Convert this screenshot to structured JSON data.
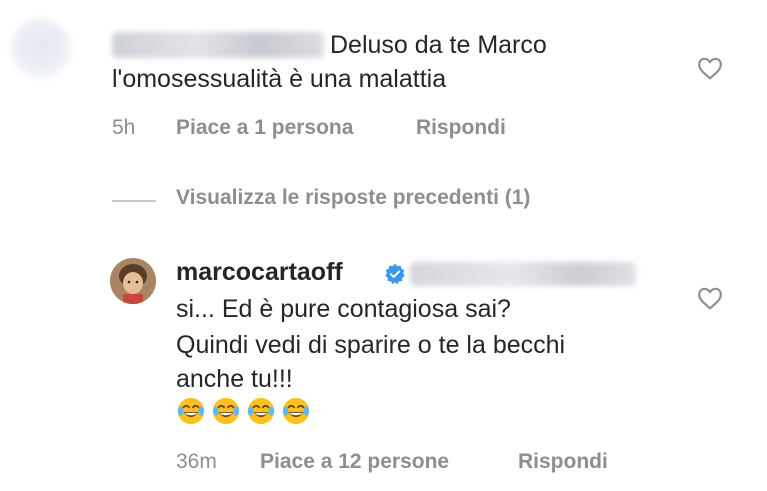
{
  "comment": {
    "text_line1": "Deluso da te Marco",
    "text_line2": "l'omosessualità è una malattia",
    "time": "5h",
    "likes": "Piace a 1 persona",
    "reply_label": "Rispondi",
    "username_blur_suffix": "_ _"
  },
  "view_replies": "Visualizza le risposte precedenti (1)",
  "reply": {
    "username": "marcocartaoff",
    "line1": "si... Ed è pure contagiosa sai?",
    "line2": "Quindi vedi di sparire o te la becchi",
    "line3": "anche tu!!!",
    "emoji_count": 4,
    "time": "36m",
    "likes": "Piace a 12 persone",
    "reply_label": "Rispondi"
  },
  "colors": {
    "text": "#262626",
    "meta": "#8e8e8e",
    "verified": "#3897f0",
    "emoji_face": "#fcc21b"
  },
  "icons": {
    "like": "heart-outline-icon",
    "verified": "verified-badge-icon",
    "emoji": "face-with-tears-of-joy-icon"
  }
}
